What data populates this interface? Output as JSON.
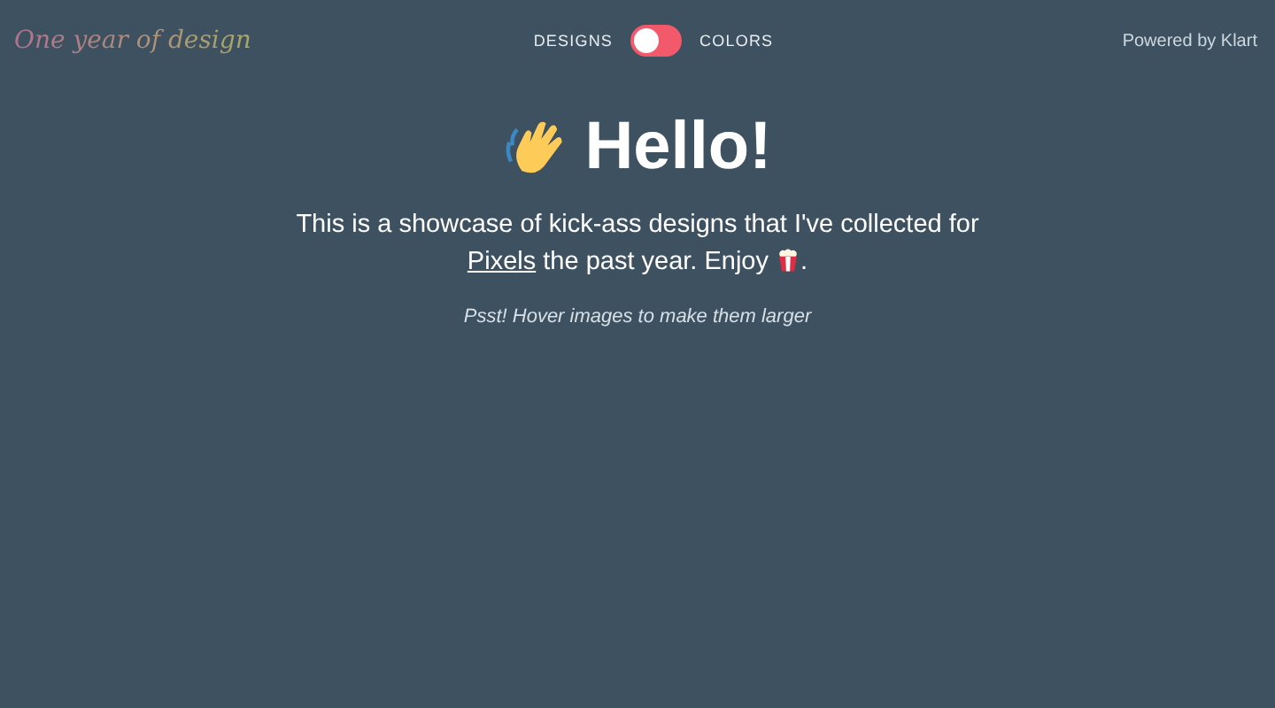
{
  "header": {
    "logo": "One year of design",
    "toggle": {
      "left_label": "DESIGNS",
      "right_label": "COLORS",
      "on": false
    },
    "credit": "Powered by Klart"
  },
  "hero": {
    "title": "Hello!",
    "intro_before": "This is a showcase of kick-ass designs that I've collected for ",
    "link": "Pixels",
    "intro_after": " the past year. Enjoy ",
    "intro_end": ".",
    "hint": "Psst! Hover images to make them larger"
  }
}
